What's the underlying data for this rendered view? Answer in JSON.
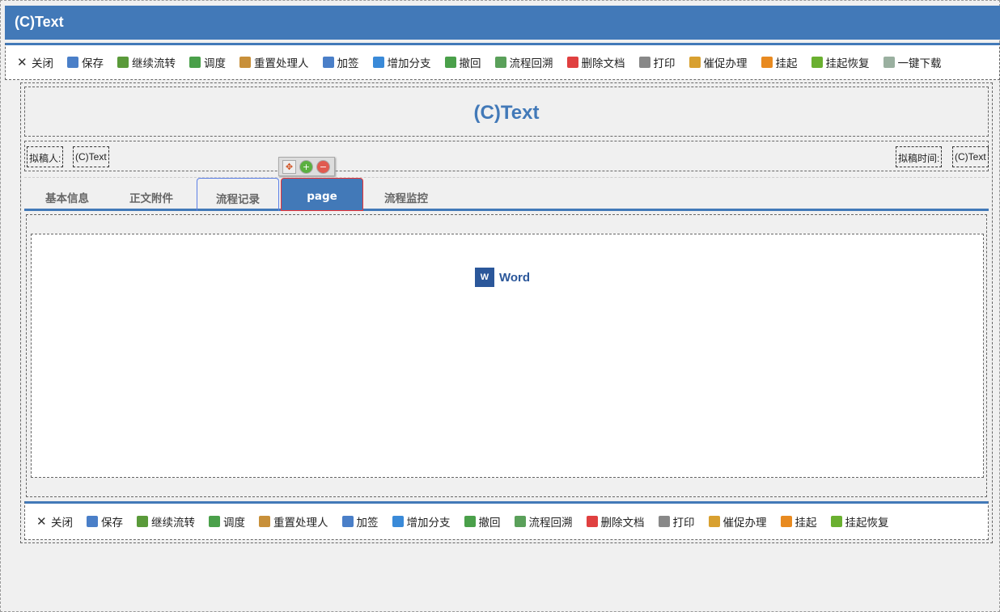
{
  "header": {
    "title": "(C)Text"
  },
  "toolbar": [
    {
      "label": "关闭",
      "icon": "close-icon",
      "color": "#333"
    },
    {
      "label": "保存",
      "icon": "save-icon",
      "color": "#4a7fc8"
    },
    {
      "label": "继续流转",
      "icon": "forward-icon",
      "color": "#5a9a3a"
    },
    {
      "label": "调度",
      "icon": "dispatch-icon",
      "color": "#4aa04a"
    },
    {
      "label": "重置处理人",
      "icon": "reset-user-icon",
      "color": "#c8903a"
    },
    {
      "label": "加签",
      "icon": "add-sign-icon",
      "color": "#4a7fc8"
    },
    {
      "label": "增加分支",
      "icon": "branch-icon",
      "color": "#3a8ad8"
    },
    {
      "label": "撤回",
      "icon": "undo-icon",
      "color": "#4aa04a"
    },
    {
      "label": "流程回溯",
      "icon": "history-icon",
      "color": "#5aa05a"
    },
    {
      "label": "删除文档",
      "icon": "delete-icon",
      "color": "#e04040"
    },
    {
      "label": "打印",
      "icon": "print-icon",
      "color": "#888"
    },
    {
      "label": "催促办理",
      "icon": "urge-icon",
      "color": "#d8a030"
    },
    {
      "label": "挂起",
      "icon": "pause-icon",
      "color": "#e88a20"
    },
    {
      "label": "挂起恢复",
      "icon": "resume-icon",
      "color": "#6ab030"
    },
    {
      "label": "一键下载",
      "icon": "download-icon",
      "color": "#9ab0a0"
    }
  ],
  "form": {
    "title": "(C)Text",
    "drafter_label": "拟稿人:",
    "drafter_value": "(C)Text",
    "date_label": "拟稿时间:",
    "date_value": "(C)Text"
  },
  "tabs": [
    "基本信息",
    "正文附件",
    "流程记录",
    "page",
    "流程监控"
  ],
  "content": {
    "word_label": "Word",
    "word_icon_text": "W"
  }
}
